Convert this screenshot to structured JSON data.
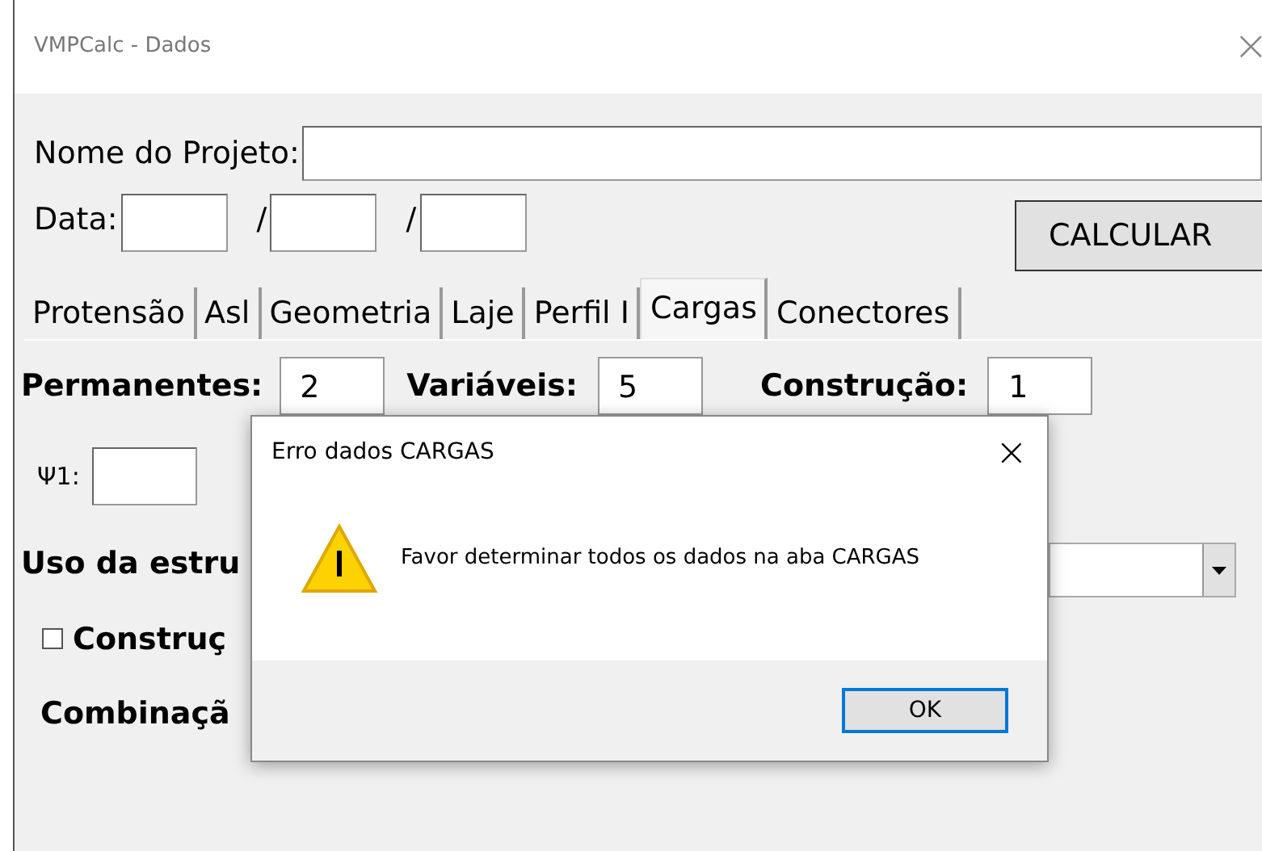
{
  "window": {
    "title": "VMPCalc - Dados",
    "close": "×"
  },
  "project": {
    "label": "Nome do Projeto:"
  },
  "date": {
    "label": "Data:",
    "separators": [
      "/",
      "/"
    ]
  },
  "calculate_button": "CALCULAR",
  "tabs": [
    {
      "label": "Protensão",
      "selected": false
    },
    {
      "label": "Asl",
      "selected": false
    },
    {
      "label": "Geometria",
      "selected": false
    },
    {
      "label": "Laje",
      "selected": false
    },
    {
      "label": "Perfil I",
      "selected": false
    },
    {
      "label": "Cargas",
      "selected": true
    },
    {
      "label": "Conectores",
      "selected": false
    }
  ],
  "counts": [
    {
      "label": "Permanentes:",
      "value": "2"
    },
    {
      "label": "Variáveis:",
      "value": "5"
    },
    {
      "label": "Construção:",
      "value": "1"
    }
  ],
  "psi1": {
    "label": "Ψ1:"
  },
  "usage": {
    "label": "Uso da estru"
  },
  "construction_checkbox": {
    "label": "Construç",
    "checked": false
  },
  "combination": {
    "label": "Combinaçã"
  },
  "dialog": {
    "title": "Erro dados CARGAS",
    "close": "×",
    "message": "Favor determinar todos os dados na aba CARGAS",
    "button": "OK"
  }
}
